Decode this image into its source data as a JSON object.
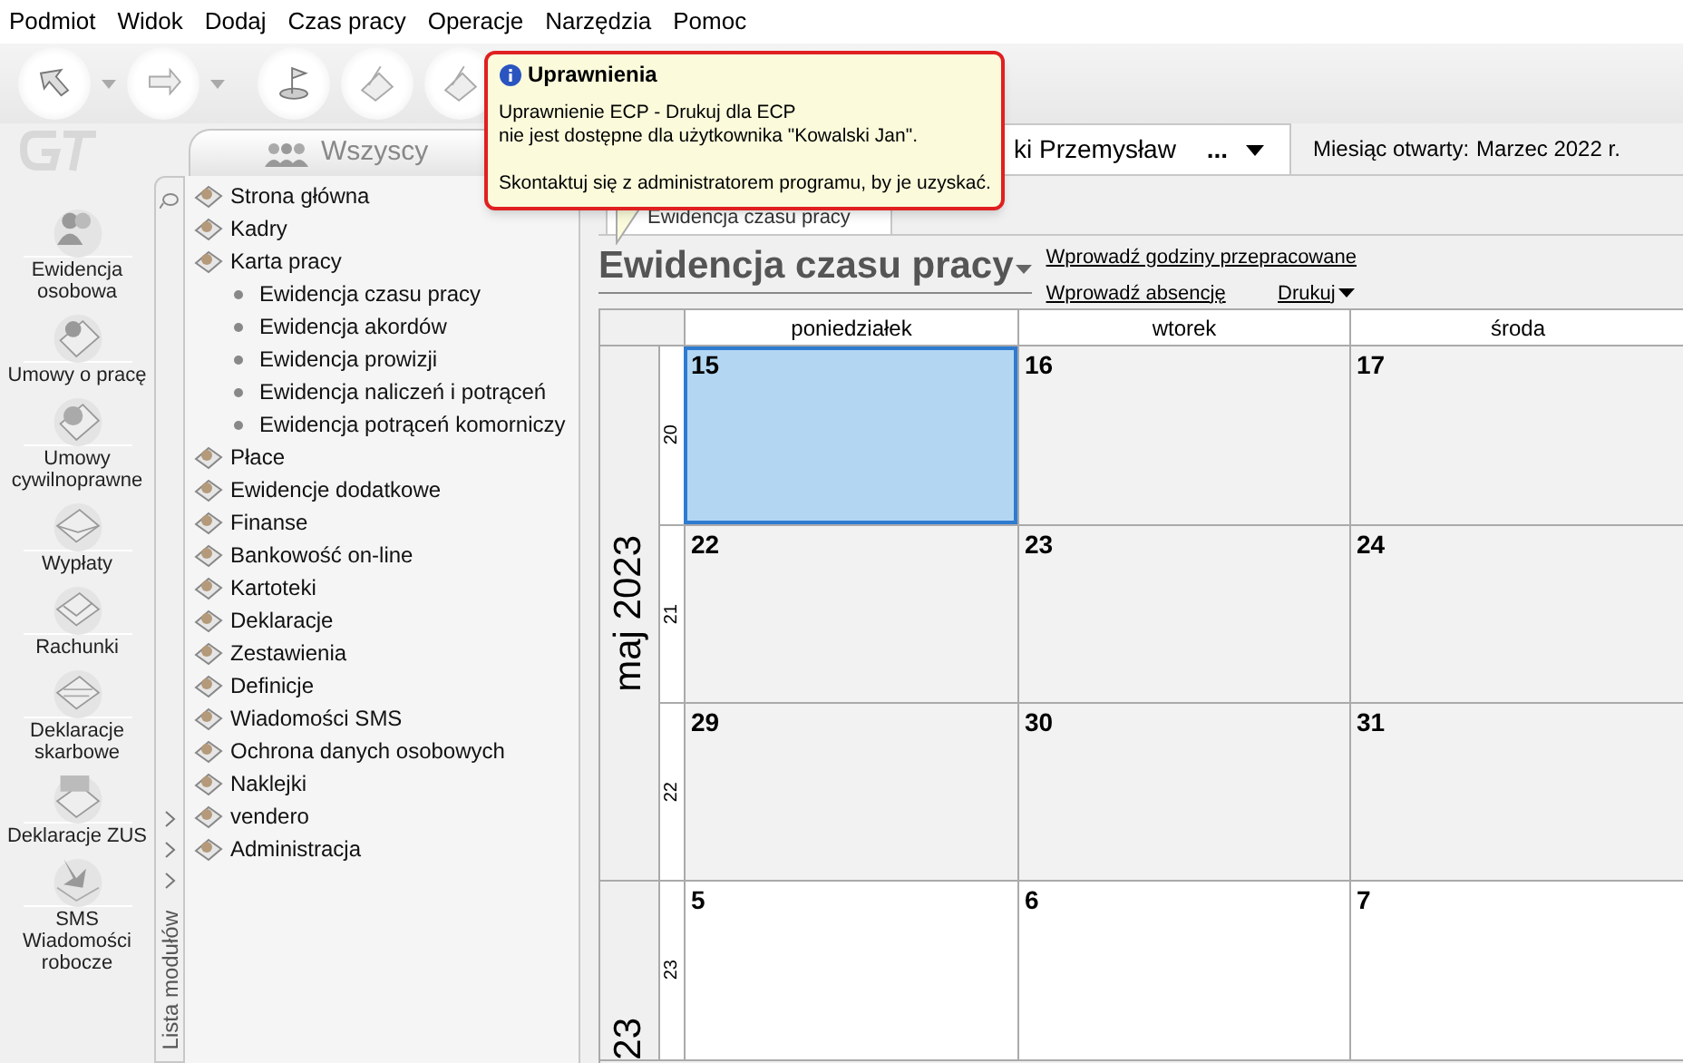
{
  "menu": [
    "Podmiot",
    "Widok",
    "Dodaj",
    "Czas pracy",
    "Operacje",
    "Narzędzia",
    "Pomoc"
  ],
  "tooltip": {
    "title": "Uprawnienia",
    "paragraphs": [
      [
        "Uprawnienie ECP - Drukuj dla ECP",
        "nie jest dostępne dla użytkownika \"Kowalski Jan\"."
      ],
      [
        "Skontaktuj się z administratorem programu, by je uzyskać."
      ]
    ]
  },
  "group_tab": {
    "label": "Wszyscy"
  },
  "employee": {
    "name": "ki Przemysław",
    "more": "..."
  },
  "open_month": {
    "label": "Miesiąc otwarty:",
    "value": "Marzec 2022 r."
  },
  "left_nav": [
    "Ewidencja osobowa",
    "Umowy o pracę",
    "Umowy cywilnoprawne",
    "Wypłaty",
    "Rachunki",
    "Deklaracje skarbowe",
    "Deklaracje ZUS",
    "SMS Wiadomości robocze"
  ],
  "module_strip": {
    "label": "Lista modułów"
  },
  "modules": [
    {
      "label": "Strona główna"
    },
    {
      "label": "Kadry"
    },
    {
      "label": "Karta pracy",
      "children": [
        {
          "label": "Ewidencja czasu pracy"
        },
        {
          "label": "Ewidencja akordów"
        },
        {
          "label": "Ewidencja prowizji"
        },
        {
          "label": "Ewidencja naliczeń i potrąceń"
        },
        {
          "label": "Ewidencja potrąceń komorniczy"
        }
      ]
    },
    {
      "label": "Płace"
    },
    {
      "label": "Ewidencje dodatkowe"
    },
    {
      "label": "Finanse"
    },
    {
      "label": "Bankowość on-line"
    },
    {
      "label": "Kartoteki"
    },
    {
      "label": "Deklaracje"
    },
    {
      "label": "Zestawienia"
    },
    {
      "label": "Definicje"
    },
    {
      "label": "Wiadomości SMS"
    },
    {
      "label": "Ochrona danych osobowych"
    },
    {
      "label": "Naklejki"
    },
    {
      "label": "vendero"
    },
    {
      "label": "Administracja"
    }
  ],
  "content_tab": {
    "label": "Ewidencja czasu pracy"
  },
  "view_title": "Ewidencja czasu pracy",
  "links": [
    {
      "label": "Wprowadź godziny przepracowane"
    },
    {
      "label": "Wprowadź absencję"
    },
    {
      "label": "Drukuj",
      "dropdown": true
    }
  ],
  "calendar": {
    "days": [
      "poniedziałek",
      "wtorek",
      "środa"
    ],
    "months": [
      {
        "label": "maj 2023",
        "weeks": [
          {
            "number": "20",
            "shaded": true,
            "days": [
              {
                "day": "15",
                "selected": true
              },
              {
                "day": "16",
                "selected": false
              },
              {
                "day": "17",
                "selected": false
              }
            ]
          },
          {
            "number": "21",
            "shaded": true,
            "days": [
              {
                "day": "22",
                "selected": false
              },
              {
                "day": "23",
                "selected": false
              },
              {
                "day": "24",
                "selected": false
              }
            ]
          },
          {
            "number": "22",
            "shaded": true,
            "days": [
              {
                "day": "29",
                "selected": false
              },
              {
                "day": "30",
                "selected": false
              },
              {
                "day": "31",
                "selected": false
              }
            ]
          }
        ]
      },
      {
        "label": "23",
        "weeks": [
          {
            "number": "23",
            "shaded": false,
            "days": [
              {
                "day": "5",
                "selected": false
              },
              {
                "day": "6",
                "selected": false
              },
              {
                "day": "7",
                "selected": false
              }
            ]
          }
        ]
      }
    ]
  }
}
